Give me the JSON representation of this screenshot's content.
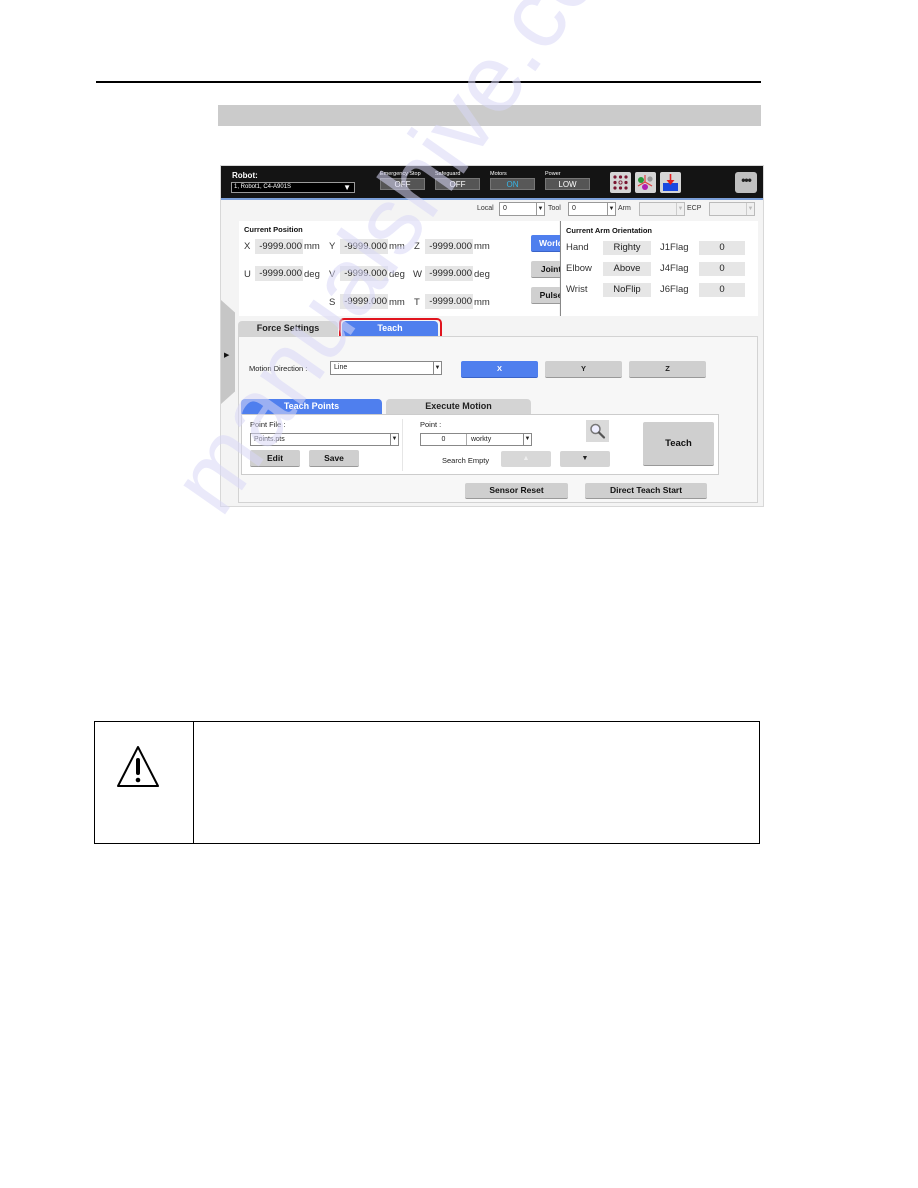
{
  "app": {
    "robot_label": "Robot:",
    "robot_selected": "1, Robot1, C4-A901S",
    "status": [
      {
        "label": "Emergency Stop",
        "value": "OFF"
      },
      {
        "label": "Safeguard",
        "value": "OFF"
      },
      {
        "label": "Motors",
        "value": "ON"
      },
      {
        "label": "Power",
        "value": "LOW"
      }
    ],
    "toolbar_icons": [
      "io-monitor-icon",
      "robot-manager-icon",
      "teach-download-icon"
    ],
    "more_label": "•••",
    "coord": {
      "local_label": "Local",
      "local_value": "0",
      "tool_label": "Tool",
      "tool_value": "0",
      "arm_label": "Arm",
      "arm_value": "",
      "ecp_label": "ECP",
      "ecp_value": ""
    },
    "position": {
      "title": "Current Position",
      "rows": [
        [
          {
            "axis": "X",
            "value": "-9999.000",
            "unit": "mm"
          },
          {
            "axis": "Y",
            "value": "-9999.000",
            "unit": "mm"
          },
          {
            "axis": "Z",
            "value": "-9999.000",
            "unit": "mm"
          }
        ],
        [
          {
            "axis": "U",
            "value": "-9999.000",
            "unit": "deg"
          },
          {
            "axis": "V",
            "value": "-9999.000",
            "unit": "deg"
          },
          {
            "axis": "W",
            "value": "-9999.000",
            "unit": "deg"
          }
        ],
        [
          {
            "axis": "S",
            "value": "-9999.000",
            "unit": "mm"
          },
          {
            "axis": "T",
            "value": "-9999.000",
            "unit": "mm"
          }
        ]
      ],
      "frame_buttons": [
        "World",
        "Joint",
        "Pulse"
      ],
      "active_frame": "World"
    },
    "orientation": {
      "title": "Current Arm Orientation",
      "rows": [
        {
          "label": "Hand",
          "value": "Righty",
          "flag_label": "J1Flag",
          "flag_value": "0"
        },
        {
          "label": "Elbow",
          "value": "Above",
          "flag_label": "J4Flag",
          "flag_value": "0"
        },
        {
          "label": "Wrist",
          "value": "NoFlip",
          "flag_label": "J6Flag",
          "flag_value": "0"
        }
      ]
    },
    "tabs": [
      {
        "label": "Force Settings",
        "active": false
      },
      {
        "label": "Teach",
        "active": true
      }
    ],
    "teach": {
      "motion_direction_label": "Motion Direction :",
      "motion_direction_value": "Line",
      "direction_buttons": [
        "X",
        "Y",
        "Z"
      ],
      "active_direction": "X",
      "subtabs": [
        {
          "label": "Teach Points",
          "active": true
        },
        {
          "label": "Execute Motion",
          "active": false
        }
      ],
      "point_file_label": "Point File :",
      "point_file_value": "Points.pts",
      "edit_label": "Edit",
      "save_label": "Save",
      "point_label": "Point :",
      "point_number": "0",
      "point_name": "workty",
      "search_empty_label": "Search Empty",
      "up_label": "▲",
      "down_label": "▼",
      "teach_label": "Teach",
      "sensor_reset_label": "Sensor Reset",
      "direct_teach_label": "Direct Teach Start"
    }
  },
  "colors": {
    "accent": "#4f7fee",
    "highlight": "#e0141e",
    "motors_on": "#36b6e8"
  },
  "watermark": "manualshive.com"
}
